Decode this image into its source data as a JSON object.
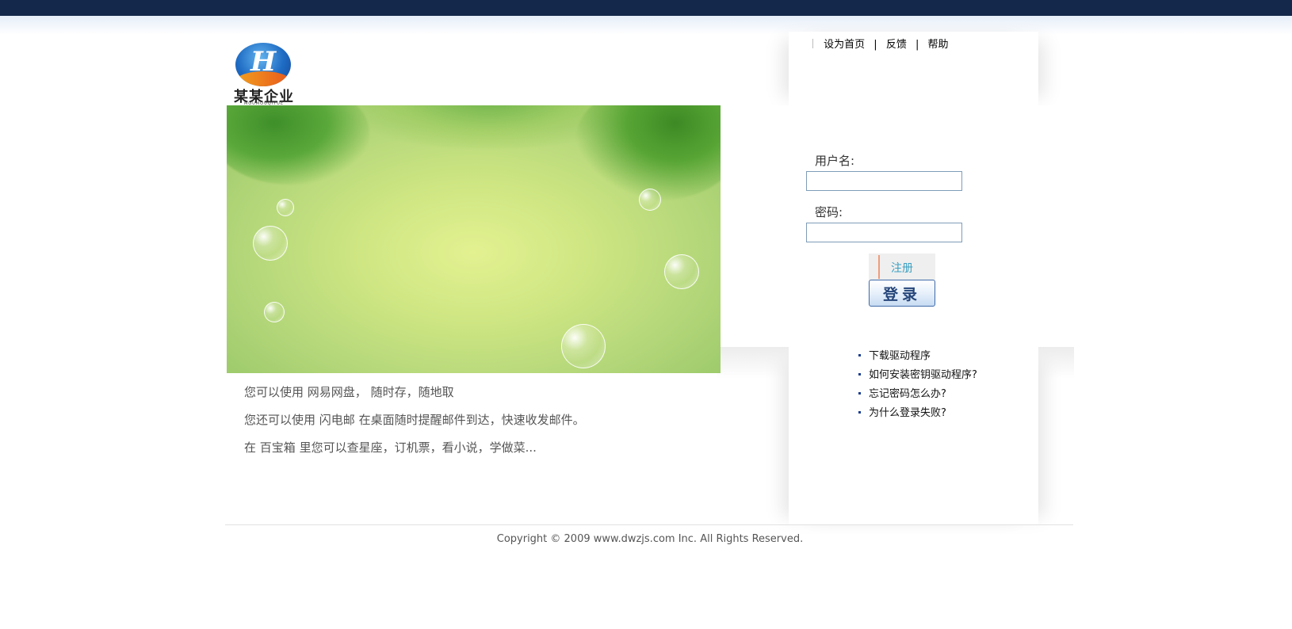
{
  "logo": {
    "name_cn": "某某企业",
    "name_en": "MOUMOUQIYUE",
    "mark": "H"
  },
  "top_links": {
    "set_home": "设为首页",
    "feedback": "反馈",
    "help": "帮助",
    "separator": "|"
  },
  "promo": {
    "line1_prefix": "您可以使用 ",
    "line1_link": "网易网盘",
    "line1_suffix": "， 随时存，随地取",
    "line2_prefix": "您还可以使用 ",
    "line2_link": "闪电邮",
    "line2_suffix": " 在桌面随时提醒邮件到达，快速收发邮件。",
    "line3_prefix": "在 ",
    "line3_link": "百宝箱",
    "line3_suffix": " 里您可以查星座，订机票，看小说，学做菜..."
  },
  "login": {
    "username_label": "用户名:",
    "username_value": "",
    "password_label": "密码:",
    "password_value": "",
    "register_button": "注册",
    "login_button": "登录"
  },
  "help_links": [
    "下载驱动程序",
    "如何安装密钥驱动程序?",
    "忘记密码怎么办?",
    "为什么登录失败?"
  ],
  "footer": {
    "copyright": "Copyright © 2009 www.dwzjs.com Inc. All Rights Reserved."
  },
  "colors": {
    "top_bar": "#13284a",
    "login_border": "#3f6aa8",
    "link_bullet": "#1a3d8f"
  }
}
